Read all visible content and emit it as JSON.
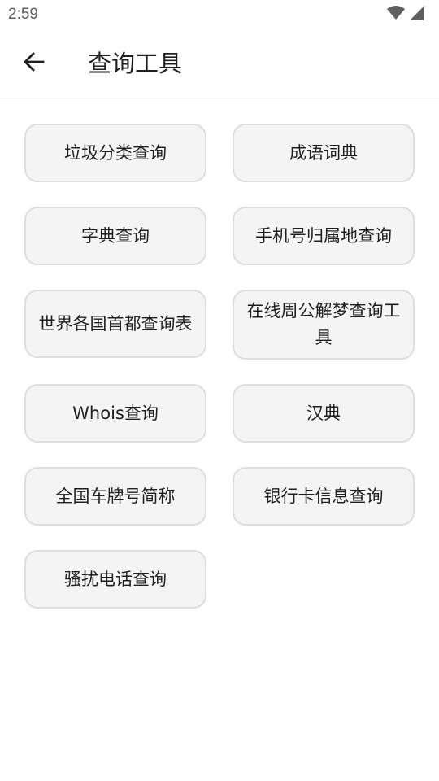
{
  "status_bar": {
    "time": "2:59",
    "icons": [
      "wifi-icon",
      "cell-signal-icon"
    ]
  },
  "app_bar": {
    "back_icon": "arrow-left-icon",
    "title": "查询工具"
  },
  "tools": [
    {
      "id": "garbage-sorting",
      "label": "垃圾分类查询"
    },
    {
      "id": "idiom-dictionary",
      "label": "成语词典"
    },
    {
      "id": "character-dictionary",
      "label": "字典查询"
    },
    {
      "id": "phone-location",
      "label": "手机号归属地查询"
    },
    {
      "id": "world-capitals",
      "label": "世界各国首都查询表"
    },
    {
      "id": "dream-interpretation",
      "label": "在线周公解梦查询工具"
    },
    {
      "id": "whois",
      "label": "Whois查询"
    },
    {
      "id": "han-dictionary",
      "label": "汉典"
    },
    {
      "id": "license-plate",
      "label": "全国车牌号简称"
    },
    {
      "id": "bank-card",
      "label": "银行卡信息查询"
    },
    {
      "id": "spam-call",
      "label": "骚扰电话查询"
    }
  ],
  "colors": {
    "button_bg": "#f4f4f4",
    "button_border": "#dedede",
    "text": "#1f1f1f",
    "status_text": "#5f5f5f"
  }
}
